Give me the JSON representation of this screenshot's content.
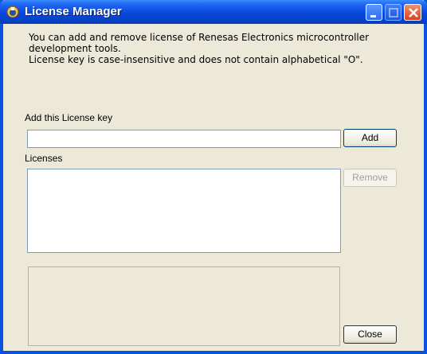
{
  "window": {
    "title": "License Manager"
  },
  "description": {
    "line1": "You can add and remove license of Renesas Electronics microcontroller",
    "line2": "development tools.",
    "line3": "License key is case-insensitive and does not contain alphabetical \"O\"."
  },
  "add_key": {
    "label": "Add this License key",
    "value": "",
    "add_button": "Add"
  },
  "licenses": {
    "label": "Licenses",
    "items": [],
    "remove_button": "Remove"
  },
  "close_button": "Close",
  "colors": {
    "titlebar": "#0a48dd",
    "window_bg": "#ece9d8",
    "close_button": "#d8421e"
  }
}
